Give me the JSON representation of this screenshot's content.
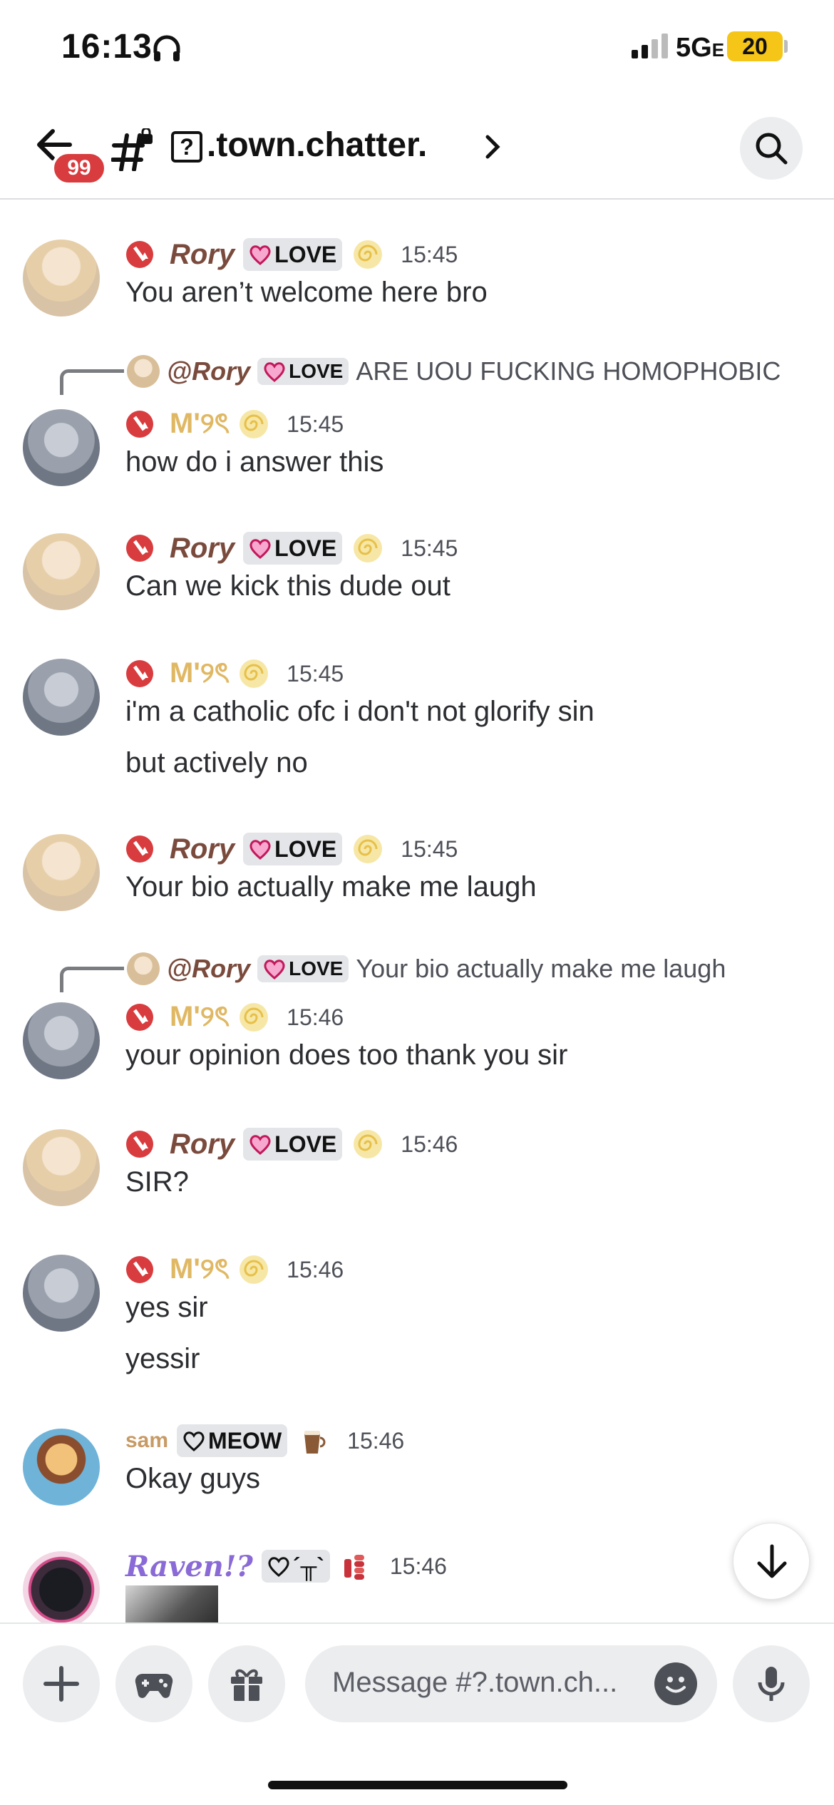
{
  "status_bar": {
    "time": "16:13",
    "network": "5G",
    "network_suffix": "E",
    "battery": "20"
  },
  "header": {
    "unread_badge": "99",
    "channel_name": ".town.chatter."
  },
  "messages": [
    {
      "author": "Rory",
      "tag": "LOVE",
      "time": "15:45",
      "lines": [
        "You aren’t welcome here bro"
      ]
    },
    {
      "reply_to": {
        "author": "@Rory",
        "tag": "LOVE",
        "text": "ARE UOU FUCKING HOMOPHOBIC"
      },
      "author": "M'୨ৎ",
      "time": "15:45",
      "lines": [
        "how do i answer this"
      ]
    },
    {
      "author": "Rory",
      "tag": "LOVE",
      "time": "15:45",
      "lines": [
        "Can we kick this dude out"
      ]
    },
    {
      "author": "M'୨ৎ",
      "time": "15:45",
      "lines": [
        "i'm a catholic ofc i don't not glorify sin",
        "but actively no"
      ]
    },
    {
      "author": "Rory",
      "tag": "LOVE",
      "time": "15:45",
      "lines": [
        "Your bio actually make me laugh"
      ]
    },
    {
      "reply_to": {
        "author": "@Rory",
        "tag": "LOVE",
        "text": "Your bio actually make me laugh"
      },
      "author": "M'୨ৎ",
      "time": "15:46",
      "lines": [
        "your opinion does too thank you sir"
      ]
    },
    {
      "author": "Rory",
      "tag": "LOVE",
      "time": "15:46",
      "lines": [
        "SIR?"
      ]
    },
    {
      "author": "M'୨ৎ",
      "time": "15:46",
      "lines": [
        "yes sir",
        "yessir"
      ]
    },
    {
      "author": "sam",
      "tag": "MEOW",
      "time": "15:46",
      "lines": [
        "Okay guys"
      ]
    },
    {
      "author": "Raven!?",
      "tag": "´╥`",
      "time": "15:46",
      "lines": []
    }
  ],
  "composer": {
    "placeholder": "Message #?.town.ch..."
  },
  "colors": {
    "badge_red": "#d83c3e",
    "rory_name": "#7a4b3d",
    "m_name": "#e0b864",
    "raven_name": "#8a6ad6"
  },
  "icons": [
    "back-arrow-icon",
    "channel-hash-lock-icon",
    "chevron-right-icon",
    "search-icon",
    "moderator-icon",
    "heart-icon",
    "swirl-emoji-icon",
    "arrow-down-icon",
    "plus-icon",
    "gamepad-icon",
    "gift-icon",
    "emoji-icon",
    "microphone-icon"
  ]
}
